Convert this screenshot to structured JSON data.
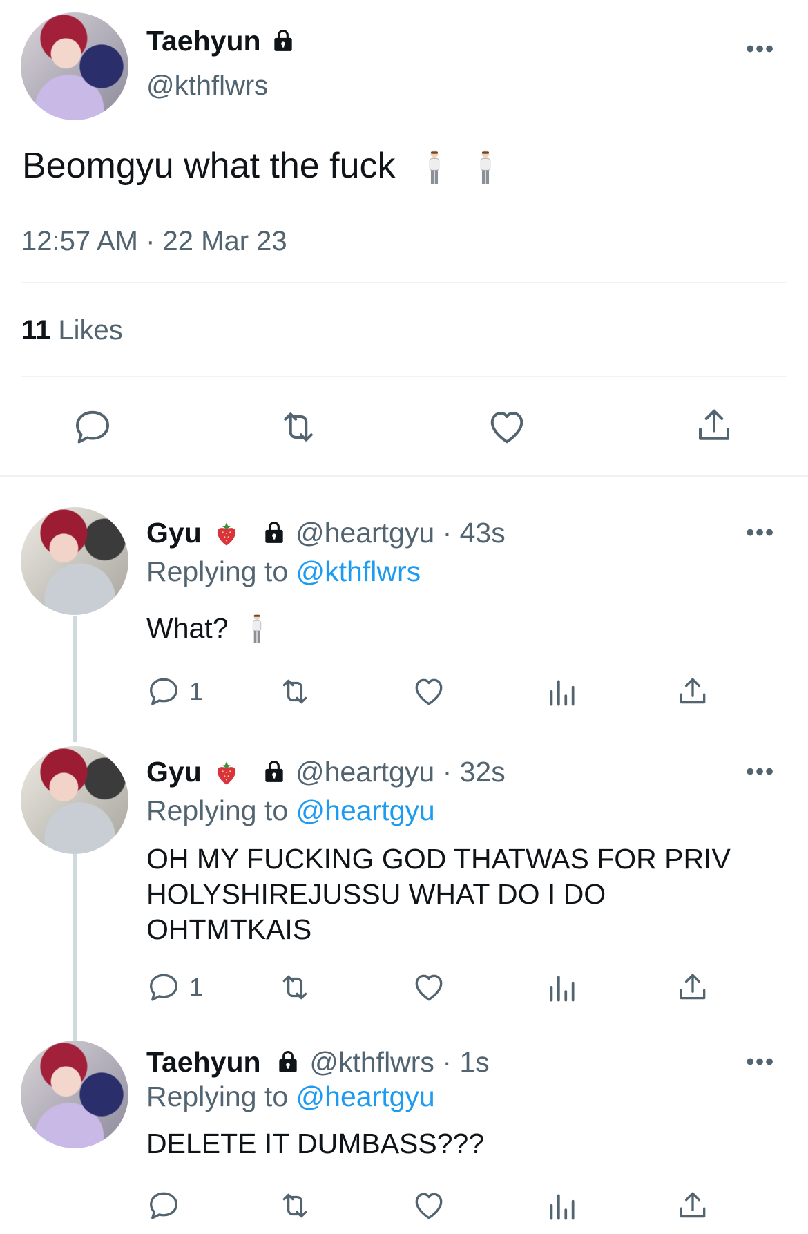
{
  "main_tweet": {
    "author_name": "Taehyun",
    "author_handle": "@kthflwrs",
    "text": "Beomgyu what the fuck",
    "timestamp": "12:57 AM · 22 Mar 23",
    "likes_count": "11",
    "likes_label": "Likes",
    "more_label": "•••"
  },
  "replies": [
    {
      "author_name": "Gyu",
      "author_handle": "@heartgyu",
      "time": "· 43s",
      "replying_prefix": "Replying to",
      "replying_to": "@kthflwrs",
      "text": "What?",
      "reply_count": "1",
      "more_label": "•••"
    },
    {
      "author_name": "Gyu",
      "author_handle": "@heartgyu",
      "time": "· 32s",
      "replying_prefix": "Replying to",
      "replying_to": "@heartgyu",
      "text_lines": [
        "OH MY FUCKING GOD THATWAS FOR PRIV",
        "HOLYSHIREJUSSU WHAT DO I DO",
        "OHTMTKAIS"
      ],
      "reply_count": "1",
      "more_label": "•••"
    },
    {
      "author_name": "Taehyun",
      "author_handle": "@kthflwrs",
      "time": "· 1s",
      "replying_prefix": "Replying to",
      "replying_to": "@heartgyu",
      "text": "DELETE IT DUMBASS???",
      "more_label": "•••"
    }
  ],
  "icons": {
    "reply": "reply-icon",
    "retweet": "retweet-icon",
    "like": "heart-icon",
    "views": "analytics-icon",
    "share": "share-icon",
    "lock": "lock-icon",
    "strawberry": "strawberry-icon",
    "person": "standing-person-icon"
  },
  "colors": {
    "link": "#1d9bf0",
    "secondary_text": "#536471",
    "divider": "#eff3f4"
  }
}
